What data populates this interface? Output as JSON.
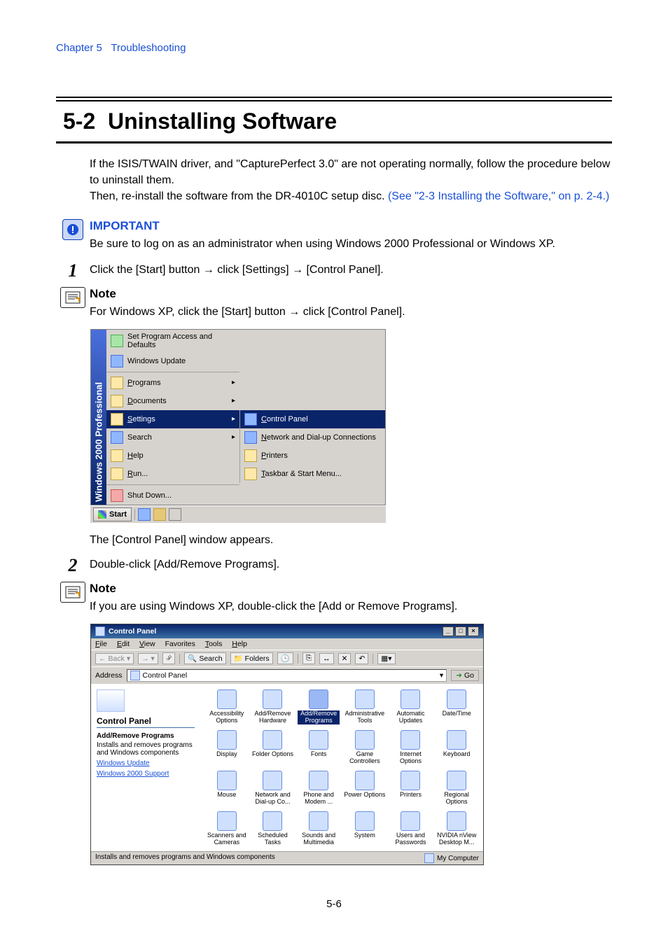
{
  "header": {
    "chapter": "Chapter 5",
    "title": "Troubleshooting"
  },
  "section": {
    "number": "5-2",
    "title": "Uninstalling Software"
  },
  "intro": {
    "p1": "If the ISIS/TWAIN driver, and \"CapturePerfect 3.0\" are not operating normally, follow the procedure below to uninstall them.",
    "p2a": "Then, re-install the software from the DR-4010C setup disc. ",
    "p2link": "(See \"2-3 Installing the Software,\" on p. 2-4.)"
  },
  "important": {
    "label": "IMPORTANT",
    "text": "Be sure to log on as an administrator when using Windows 2000 Professional or Windows XP."
  },
  "steps": {
    "s1": {
      "num": "1",
      "text_a": "Click the [Start] button ",
      "text_b": " click [Settings] ",
      "text_c": " [Control Panel]."
    },
    "s2": {
      "num": "2",
      "text": "Double-click [Add/Remove Programs]."
    }
  },
  "note1": {
    "label": "Note",
    "text_a": "For Windows XP, click the [Start] button ",
    "text_b": " click [Control Panel]."
  },
  "caption1": "The [Control Panel] window appears.",
  "note2": {
    "label": "Note",
    "text": "If you are using Windows XP, double-click the [Add or Remove Programs]."
  },
  "startmenu": {
    "sidebar": "Windows 2000 Professional",
    "items_top": [
      "Set Program Access and Defaults",
      "Windows Update"
    ],
    "items_main": [
      "Programs",
      "Documents",
      "Settings",
      "Search",
      "Help",
      "Run...",
      "Shut Down..."
    ],
    "submenu": [
      "Control Panel",
      "Network and Dial-up Connections",
      "Printers",
      "Taskbar & Start Menu..."
    ],
    "start": "Start"
  },
  "cpanel": {
    "title": "Control Panel",
    "menus": [
      "File",
      "Edit",
      "View",
      "Favorites",
      "Tools",
      "Help"
    ],
    "toolbar": {
      "back": "Back",
      "search": "Search",
      "folders": "Folders"
    },
    "address_label": "Address",
    "address_value": "Control Panel",
    "go": "Go",
    "left": {
      "heading": "Control Panel",
      "bold": "Add/Remove Programs",
      "desc": "Installs and removes programs and Windows components",
      "links": [
        "Windows Update",
        "Windows 2000 Support"
      ]
    },
    "icons": [
      "Accessibility Options",
      "Add/Remove Hardware",
      "Add/Remove Programs",
      "Administrative Tools",
      "Automatic Updates",
      "Date/Time",
      "Display",
      "Folder Options",
      "Fonts",
      "Game Controllers",
      "Internet Options",
      "Keyboard",
      "Mouse",
      "Network and Dial-up Co...",
      "Phone and Modem ...",
      "Power Options",
      "Printers",
      "Regional Options",
      "Scanners and Cameras",
      "Scheduled Tasks",
      "Sounds and Multimedia",
      "System",
      "Users and Passwords",
      "NVIDIA nView Desktop M..."
    ],
    "status_left": "Installs and removes programs and Windows components",
    "status_right": "My Computer"
  },
  "footer": {
    "page": "5-6"
  }
}
